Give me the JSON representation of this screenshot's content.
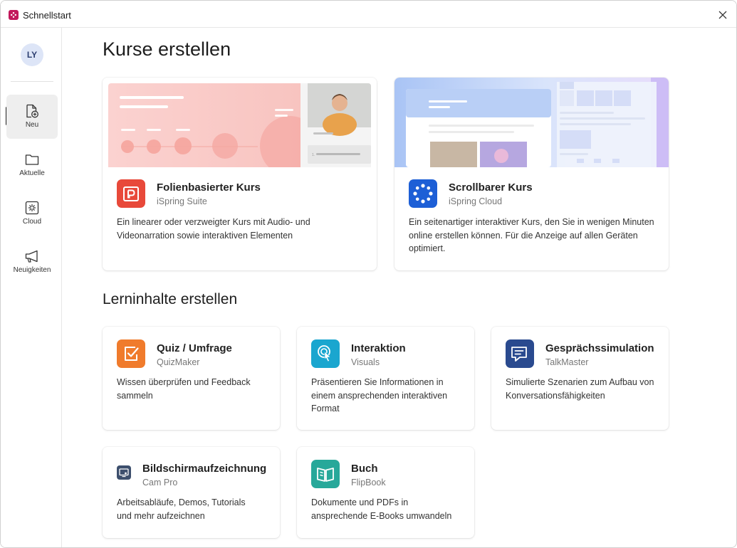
{
  "window": {
    "title": "Schnellstart"
  },
  "user": {
    "initials": "LY"
  },
  "sidebar": {
    "items": [
      {
        "label": "Neu",
        "icon": "new-file-icon"
      },
      {
        "label": "Aktuelle",
        "icon": "folder-icon"
      },
      {
        "label": "Cloud",
        "icon": "cloud-icon"
      },
      {
        "label": "Neuigkeiten",
        "icon": "megaphone-icon"
      }
    ]
  },
  "courses": {
    "heading": "Kurse erstellen",
    "cards": [
      {
        "title": "Folienbasierter Kurs",
        "subtitle": "iSpring Suite",
        "description": "Ein linearer oder verzweigter Kurs mit Audio- und Videonarration sowie interaktiven Elementen",
        "banner_label": "1."
      },
      {
        "title": "Scrollbarer Kurs",
        "subtitle": "iSpring Cloud",
        "description": "Ein seitenartiger interaktiver Kurs, den Sie in wenigen Minuten online erstellen können. Für die Anzeige auf allen Geräten optimiert."
      }
    ]
  },
  "content": {
    "heading": "Lerninhalte erstellen",
    "cards": [
      {
        "title": "Quiz / Umfrage",
        "subtitle": "QuizMaker",
        "description": "Wissen überprüfen und Feedback sammeln",
        "color": "#f07b2c"
      },
      {
        "title": "Interaktion",
        "subtitle": "Visuals",
        "description": "Präsentieren Sie Informationen in einem ansprechenden interaktiven Format",
        "color": "#1aa6cf"
      },
      {
        "title": "Gesprächssimulation",
        "subtitle": "TalkMaster",
        "description": "Simulierte Szenarien zum Aufbau von Konversationsfähigkeiten",
        "color": "#2a4a8f"
      },
      {
        "title": "Bildschirmaufzeichnung",
        "subtitle": "Cam Pro",
        "description": "Arbeitsabläufe, Demos, Tutorials und mehr aufzeichnen",
        "color": "#3d4f6d"
      },
      {
        "title": "Buch",
        "subtitle": "FlipBook",
        "description": "Dokumente und PDFs in ansprechende E-Books umwandeln",
        "color": "#27a89a"
      }
    ]
  }
}
